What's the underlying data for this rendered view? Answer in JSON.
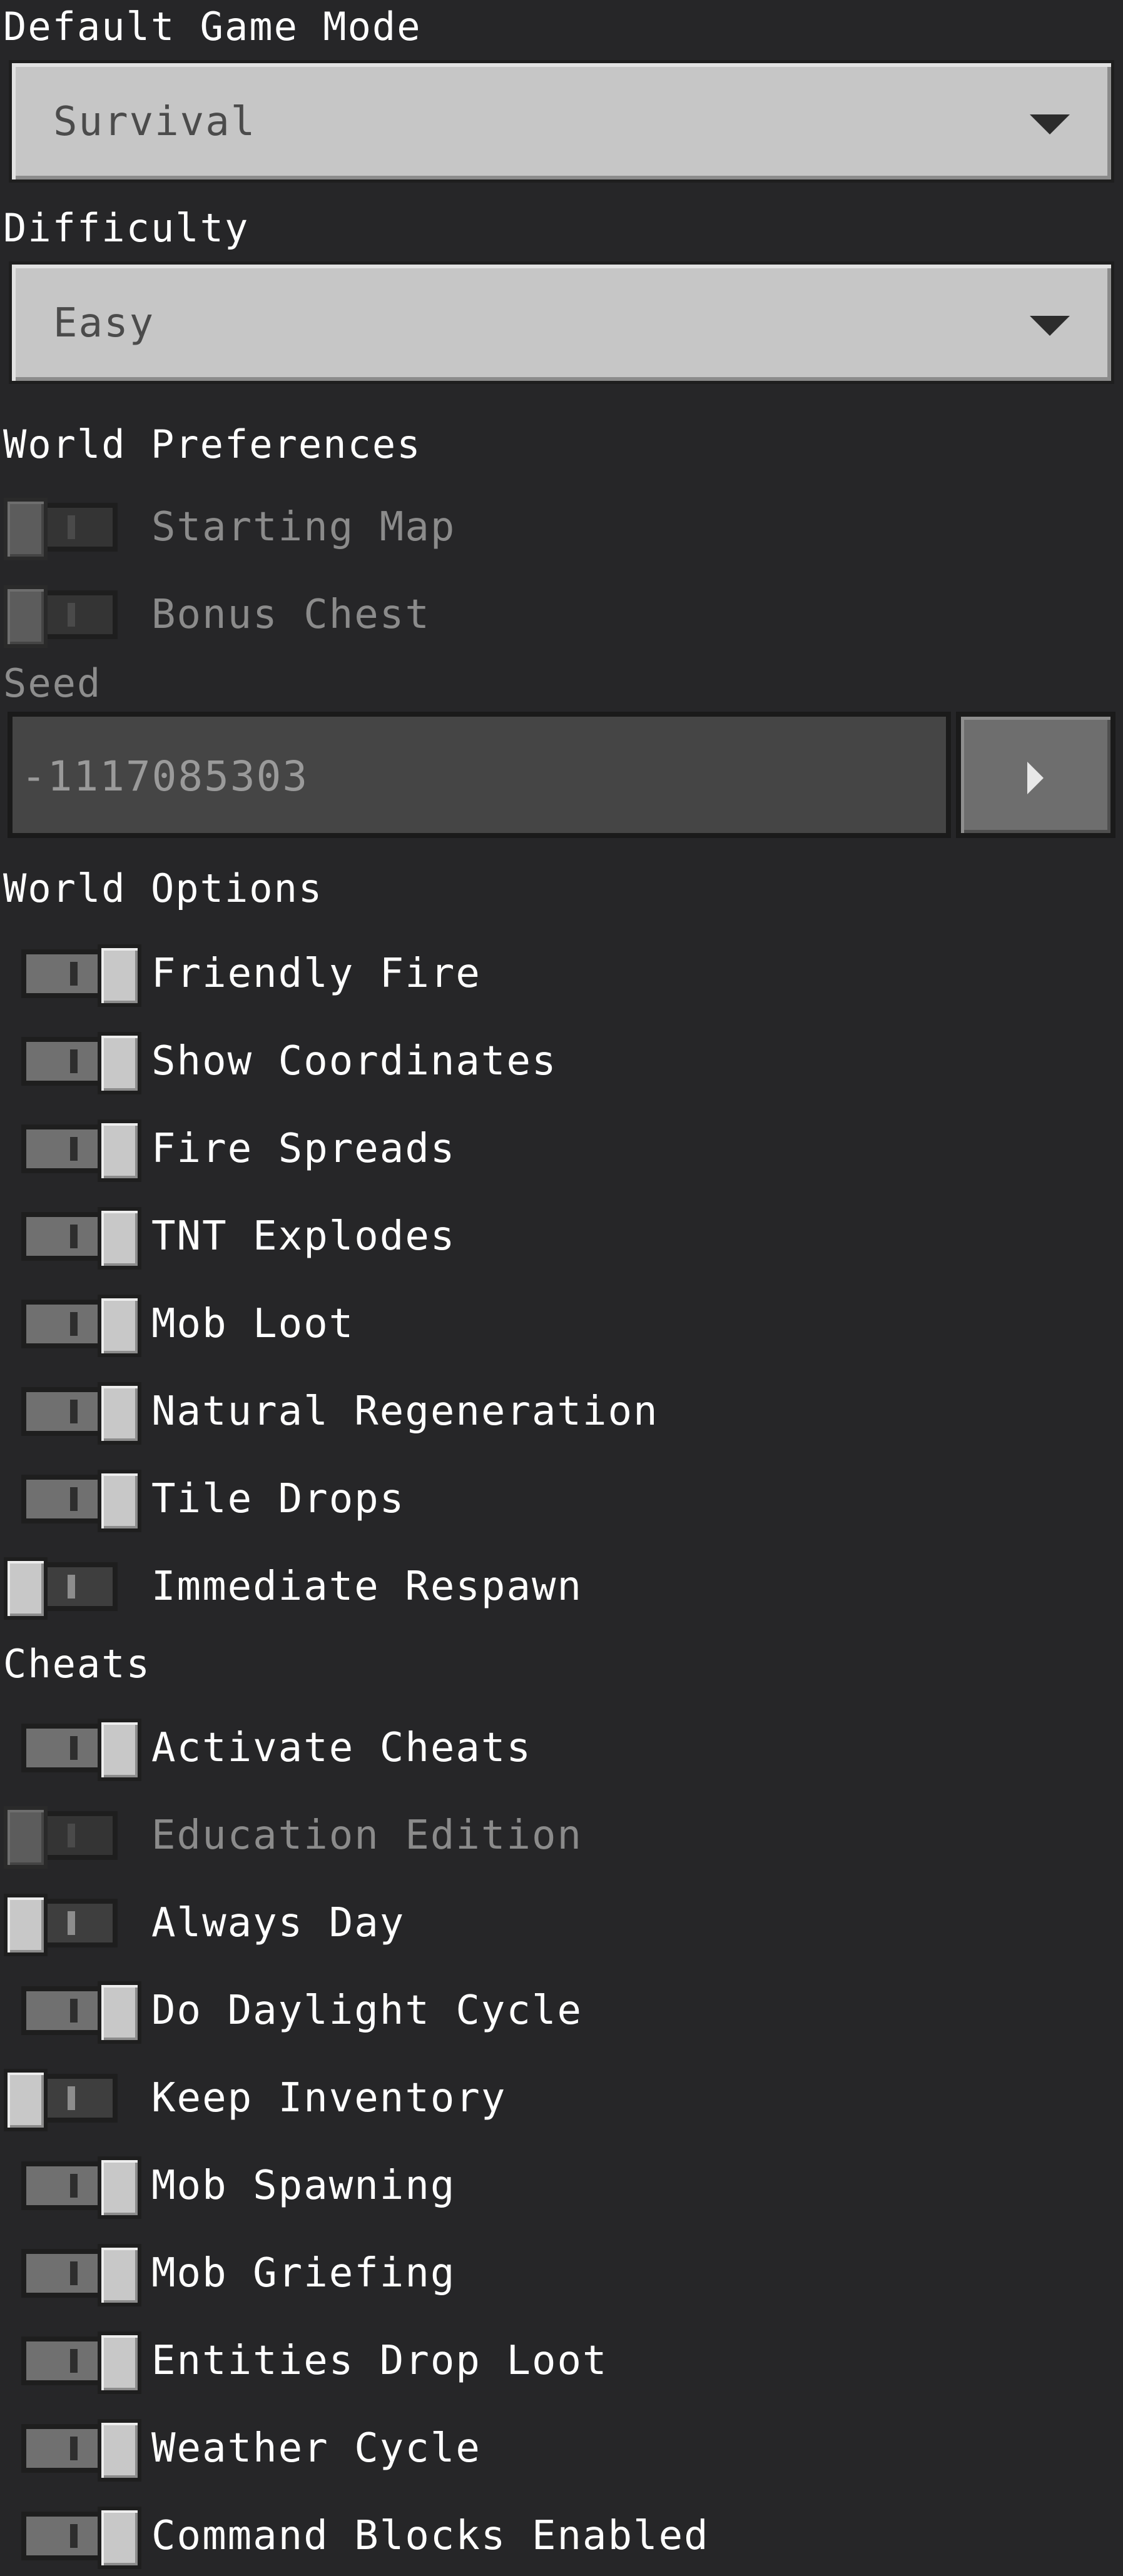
{
  "game_mode": {
    "label": "Default Game Mode",
    "value": "Survival"
  },
  "difficulty": {
    "label": "Difficulty",
    "value": "Easy"
  },
  "world_preferences": {
    "label": "World Preferences",
    "items": [
      {
        "label": "Starting Map",
        "state": "disabled"
      },
      {
        "label": "Bonus Chest",
        "state": "disabled"
      }
    ]
  },
  "seed": {
    "label": "Seed",
    "value": "-1117085303"
  },
  "world_options": {
    "label": "World Options",
    "items": [
      {
        "label": "Friendly Fire",
        "state": "on"
      },
      {
        "label": "Show Coordinates",
        "state": "on"
      },
      {
        "label": "Fire Spreads",
        "state": "on"
      },
      {
        "label": "TNT Explodes",
        "state": "on"
      },
      {
        "label": "Mob Loot",
        "state": "on"
      },
      {
        "label": "Natural Regeneration",
        "state": "on"
      },
      {
        "label": "Tile Drops",
        "state": "on"
      },
      {
        "label": "Immediate Respawn",
        "state": "off"
      }
    ]
  },
  "cheats": {
    "label": "Cheats",
    "items": [
      {
        "label": "Activate Cheats",
        "state": "on"
      },
      {
        "label": "Education Edition",
        "state": "disabled"
      },
      {
        "label": "Always Day",
        "state": "off"
      },
      {
        "label": "Do Daylight Cycle",
        "state": "on"
      },
      {
        "label": "Keep Inventory",
        "state": "off"
      },
      {
        "label": "Mob Spawning",
        "state": "on"
      },
      {
        "label": "Mob Griefing",
        "state": "on"
      },
      {
        "label": "Entities Drop Loot",
        "state": "on"
      },
      {
        "label": "Weather Cycle",
        "state": "on"
      },
      {
        "label": "Command Blocks Enabled",
        "state": "on"
      }
    ]
  }
}
